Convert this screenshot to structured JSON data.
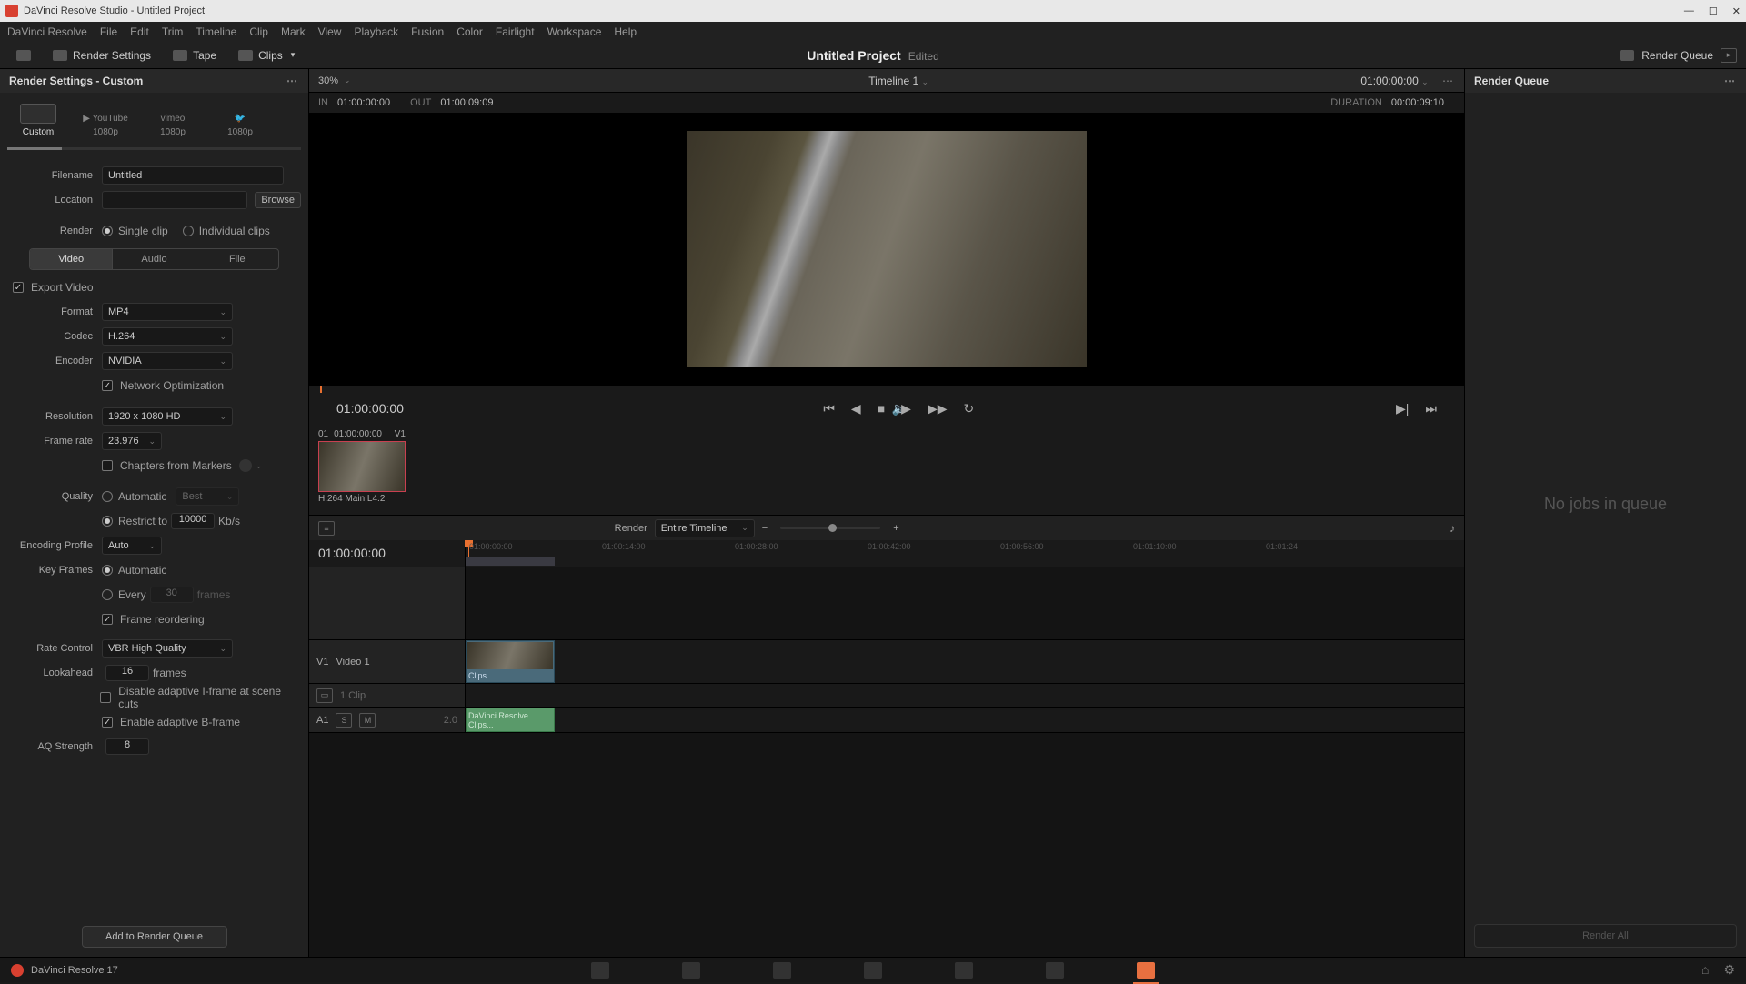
{
  "titlebar": {
    "title": "DaVinci Resolve Studio - Untitled Project"
  },
  "menu": [
    "DaVinci Resolve",
    "File",
    "Edit",
    "Trim",
    "Timeline",
    "Clip",
    "Mark",
    "View",
    "Playback",
    "Fusion",
    "Color",
    "Fairlight",
    "Workspace",
    "Help"
  ],
  "toolbar": {
    "render_settings": "Render Settings",
    "tape": "Tape",
    "clips": "Clips",
    "project": "Untitled Project",
    "edited": "Edited",
    "render_queue": "Render Queue"
  },
  "left_panel": {
    "title": "Render Settings - Custom"
  },
  "presets": {
    "custom": "Custom",
    "youtube": "1080p",
    "youtube_name": "▶ YouTube",
    "vimeo": "1080p",
    "vimeo_name": "vimeo",
    "twitter": "1080p"
  },
  "form": {
    "filename_label": "Filename",
    "filename": "Untitled",
    "location_label": "Location",
    "location": "",
    "browse": "Browse",
    "render_label": "Render",
    "single_clip": "Single clip",
    "individual": "Individual clips",
    "tab_video": "Video",
    "tab_audio": "Audio",
    "tab_file": "File",
    "export_video": "Export Video",
    "format_label": "Format",
    "format": "MP4",
    "codec_label": "Codec",
    "codec": "H.264",
    "encoder_label": "Encoder",
    "encoder": "NVIDIA",
    "network_opt": "Network Optimization",
    "resolution_label": "Resolution",
    "resolution": "1920 x 1080 HD",
    "frame_rate_label": "Frame rate",
    "frame_rate": "23.976",
    "chapters": "Chapters from Markers",
    "quality_label": "Quality",
    "quality_auto": "Automatic",
    "quality_best": "Best",
    "restrict": "Restrict to",
    "restrict_val": "10000",
    "kbps": "Kb/s",
    "enc_profile_label": "Encoding Profile",
    "enc_profile": "Auto",
    "keyframes_label": "Key Frames",
    "kf_auto": "Automatic",
    "kf_every": "Every",
    "kf_n": "30",
    "kf_frames": "frames",
    "frame_reorder": "Frame reordering",
    "rate_ctrl_label": "Rate Control",
    "rate_ctrl": "VBR High Quality",
    "lookahead_label": "Lookahead",
    "lookahead": "16",
    "lookahead_frames": "frames",
    "disable_iframe": "Disable adaptive I-frame at scene cuts",
    "enable_bframe": "Enable adaptive B-frame",
    "aq_label": "AQ Strength",
    "aq_val": "8",
    "add_to_queue": "Add to Render Queue"
  },
  "viewer": {
    "zoom": "30%",
    "timeline": "Timeline 1",
    "tc": "01:00:00:00",
    "in_label": "IN",
    "in": "01:00:00:00",
    "out_label": "OUT",
    "out": "01:00:09:09",
    "dur_label": "DURATION",
    "dur": "00:00:09:10",
    "transport_tc": "01:00:00:00"
  },
  "clip": {
    "idx": "01",
    "tc": "01:00:00:00",
    "track": "V1",
    "name": "H.264 Main L4.2"
  },
  "tl_tool": {
    "render": "Render",
    "range": "Entire Timeline"
  },
  "ruler": {
    "tc": "01:00:00:00",
    "ticks": [
      "01:00:00:00",
      "01:00:14:00",
      "01:00:28:00",
      "01:00:42:00",
      "01:00:56:00",
      "01:01:10:00",
      "01:01:24"
    ]
  },
  "tracks": {
    "v1": "V1",
    "v1_name": "Video 1",
    "v1_count": "1 Clip",
    "a1": "A1",
    "a1_s": "S",
    "a1_m": "M",
    "a1_meter": "2.0",
    "clip_name": "DaVinci Resolve Clips..."
  },
  "queue": {
    "title": "Render Queue",
    "empty": "No jobs in queue",
    "render_all": "Render All"
  },
  "footer": {
    "app": "DaVinci Resolve 17"
  }
}
